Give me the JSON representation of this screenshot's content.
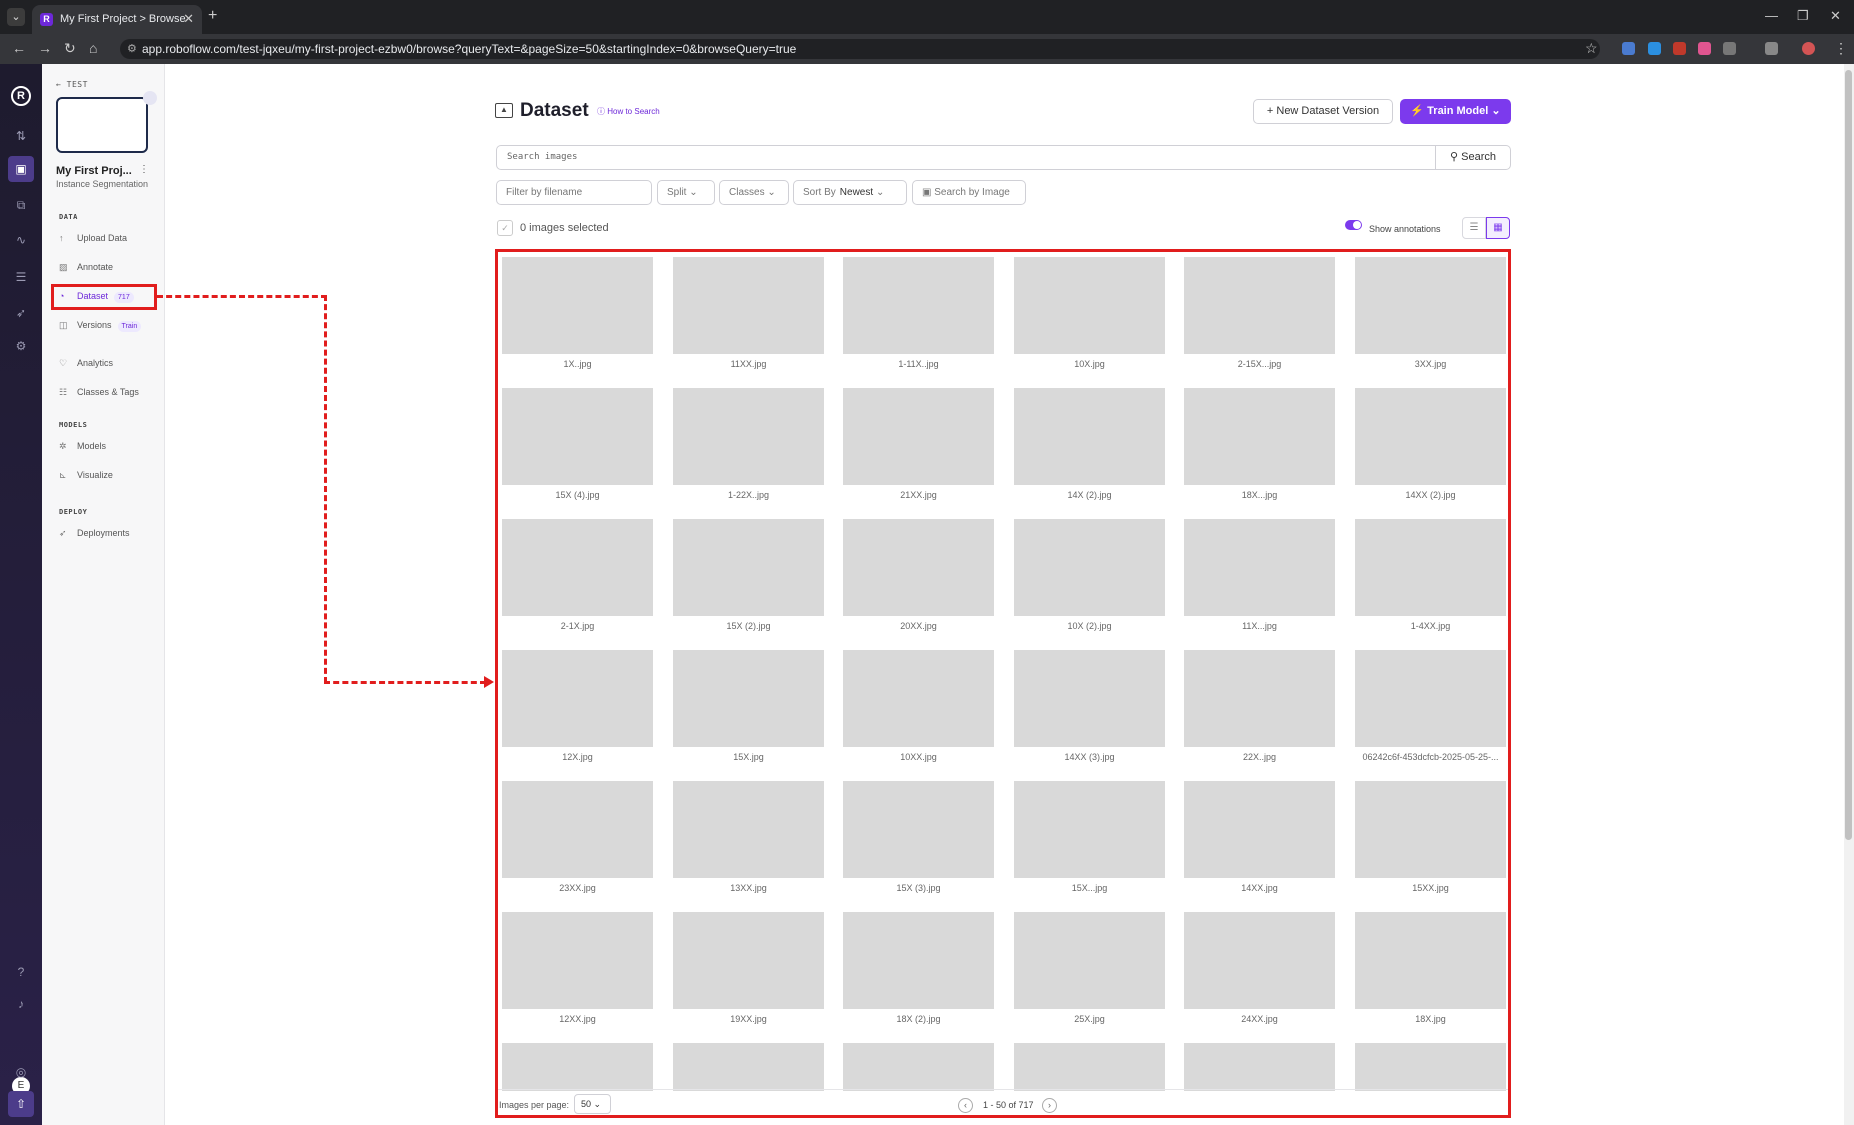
{
  "browser": {
    "tab_title": "My First Project > Browse",
    "tab_close": "✕",
    "new_tab": "+",
    "url": "app.roboflow.com/test-jqxeu/my-first-project-ezbw0/browse?queryText=&pageSize=50&startingIndex=0&browseQuery=true"
  },
  "sidebar": {
    "back_label": "TEST",
    "project_name": "My First Proj...",
    "project_type": "Instance Segmentation",
    "sections": {
      "data": "DATA",
      "models": "MODELS",
      "deploy": "DEPLOY"
    },
    "items": [
      {
        "label": "Upload Data",
        "icon": "upload-icon"
      },
      {
        "label": "Annotate",
        "icon": "annotate-icon"
      },
      {
        "label": "Dataset",
        "icon": "dataset-icon",
        "badge": "717"
      },
      {
        "label": "Versions",
        "icon": "versions-icon",
        "badge": "Train"
      },
      {
        "label": "Analytics",
        "icon": "analytics-icon"
      },
      {
        "label": "Classes & Tags",
        "icon": "list-icon"
      },
      {
        "label": "Models",
        "icon": "models-icon"
      },
      {
        "label": "Visualize",
        "icon": "chart-icon"
      },
      {
        "label": "Deployments",
        "icon": "rocket-icon"
      }
    ],
    "avatar_letter": "E"
  },
  "main": {
    "title": "Dataset",
    "how_to_search": "How to Search",
    "new_version_label": "New Dataset Version",
    "train_model_label": "Train Model",
    "search_placeholder": "Search images",
    "search_button": "Search",
    "filter_filename_placeholder": "Filter by filename",
    "split_label": "Split",
    "classes_label": "Classes",
    "sort_by_label": "Sort By",
    "sort_by_value": "Newest",
    "search_by_image_label": "Search by Image",
    "selected_text": "0 images selected",
    "show_annotations_label": "Show annotations",
    "images": [
      "1X..jpg",
      "11XX.jpg",
      "1-11X..jpg",
      "10X.jpg",
      "2-15X...jpg",
      "3XX.jpg",
      "15X (4).jpg",
      "1-22X..jpg",
      "21XX.jpg",
      "14X (2).jpg",
      "18X...jpg",
      "14XX (2).jpg",
      "2-1X.jpg",
      "15X (2).jpg",
      "20XX.jpg",
      "10X (2).jpg",
      "11X...jpg",
      "1-4XX.jpg",
      "12X.jpg",
      "15X.jpg",
      "10XX.jpg",
      "14XX (3).jpg",
      "22X..jpg",
      "06242c6f-453dcfcb-2025-05-25-...",
      "23XX.jpg",
      "13XX.jpg",
      "15X (3).jpg",
      "15X...jpg",
      "14XX.jpg",
      "15XX.jpg",
      "12XX.jpg",
      "19XX.jpg",
      "18X (2).jpg",
      "25X.jpg",
      "24XX.jpg",
      "18X.jpg",
      "",
      "",
      "",
      "",
      "",
      ""
    ],
    "images_per_page_label": "Images per page:",
    "images_per_page_value": "50",
    "pagination_text": "1 - 50 of 717"
  },
  "colors": {
    "accent": "#7c3aed",
    "highlight": "#e11d1d"
  }
}
